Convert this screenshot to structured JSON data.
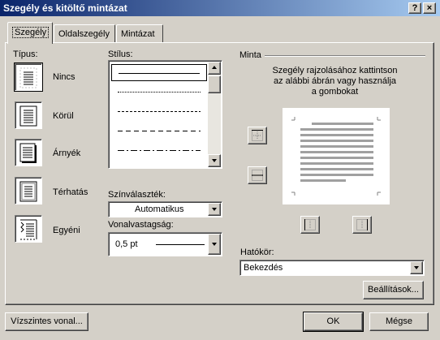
{
  "window": {
    "title": "Szegély és kitöltő mintázat",
    "help_btn": "?",
    "close_btn": "×"
  },
  "tabs": [
    {
      "label": "Szegély",
      "active": true
    },
    {
      "label": "Oldalszegély",
      "active": false
    },
    {
      "label": "Mintázat",
      "active": false
    }
  ],
  "type_section": {
    "label": "Típus:",
    "options": [
      {
        "label": "Nincs",
        "icon": "border-none-icon",
        "selected": true
      },
      {
        "label": "Körül",
        "icon": "border-box-icon",
        "selected": false
      },
      {
        "label": "Árnyék",
        "icon": "border-shadow-icon",
        "selected": false
      },
      {
        "label": "Térhatás",
        "icon": "border-3d-icon",
        "selected": false
      },
      {
        "label": "Egyéni",
        "icon": "border-custom-icon",
        "selected": false
      }
    ]
  },
  "style_section": {
    "label": "Stílus:",
    "items": [
      {
        "style": "solid"
      },
      {
        "style": "dotted"
      },
      {
        "style": "dashed-small"
      },
      {
        "style": "dashed"
      },
      {
        "style": "dash-dot"
      }
    ],
    "selected_index": 0
  },
  "color": {
    "label": "Színválaszték:",
    "value": "Automatikus"
  },
  "width": {
    "label": "Vonalvastagság:",
    "value": "0,5 pt"
  },
  "preview": {
    "group_label": "Minta",
    "instructions": [
      "Szegély rajzolásához kattintson",
      "az alábbi ábrán vagy használja",
      "a gombokat"
    ]
  },
  "apply_to": {
    "label": "Hatókör:",
    "value": "Bekezdés"
  },
  "buttons": {
    "options": "Beállítások...",
    "horizontal_line": "Vízszintes vonal...",
    "ok": "OK",
    "cancel": "Mégse"
  }
}
